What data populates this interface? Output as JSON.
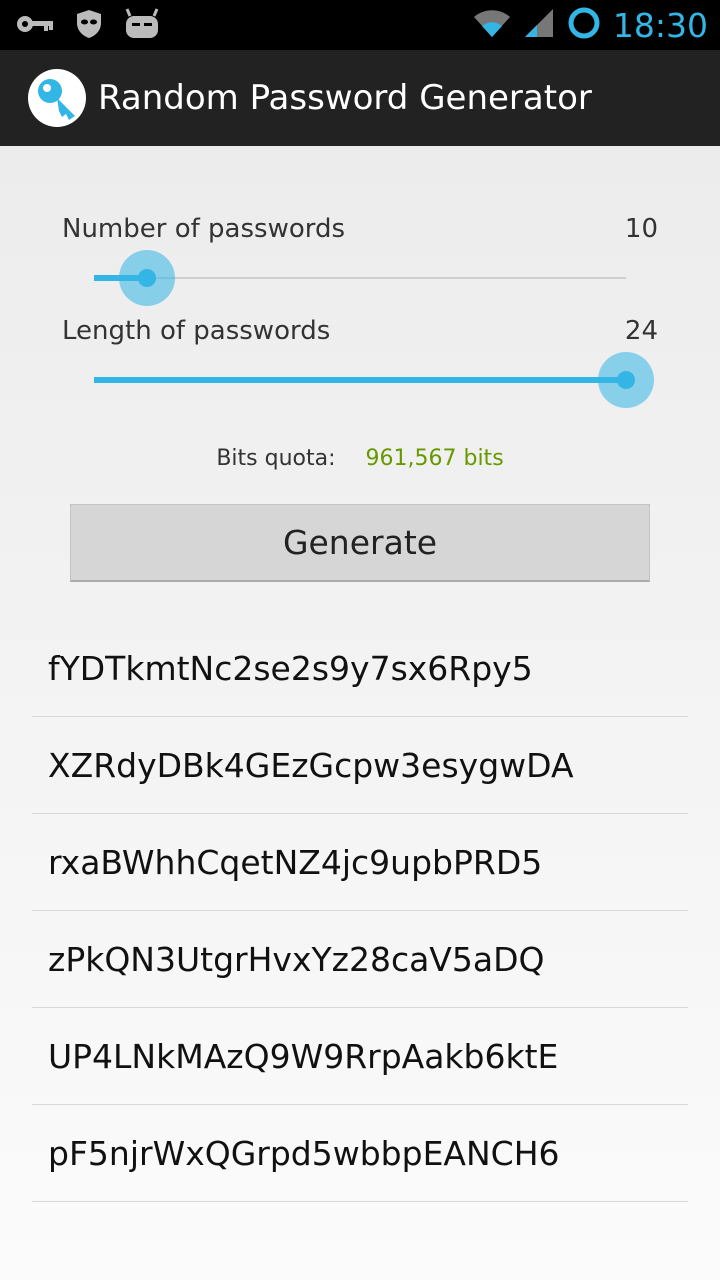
{
  "status_bar": {
    "time": "18:30",
    "icons": [
      "key-icon",
      "privacy-guard-icon",
      "cyanogen-icon",
      "wifi-icon",
      "signal-icon",
      "sync-icon"
    ]
  },
  "action_bar": {
    "title": "Random Password Generator",
    "icon": "key-app-icon"
  },
  "controls": {
    "count_label": "Number of passwords",
    "count_value": "10",
    "count_slider_fraction": 0.1,
    "length_label": "Length of passwords",
    "length_value": "24",
    "length_slider_fraction": 1.0,
    "quota_label": "Bits quota:",
    "quota_value": "961,567 bits",
    "generate_label": "Generate"
  },
  "passwords": [
    "fYDTkmtNc2se2s9y7sx6Rpy5",
    "XZRdyDBk4GEzGcpw3esygwDA",
    "rxaBWhhCqetNZ4jc9upbPRD5",
    "zPkQN3UtgrHvxYz28caV5aDQ",
    "UP4LNkMAzQ9W9RrpAakb6ktE",
    "pF5njrWxQGrpd5wbbpEANCH6"
  ],
  "colors": {
    "accent": "#33b5e5",
    "quota_value": "#669900",
    "action_bar": "#222222"
  }
}
